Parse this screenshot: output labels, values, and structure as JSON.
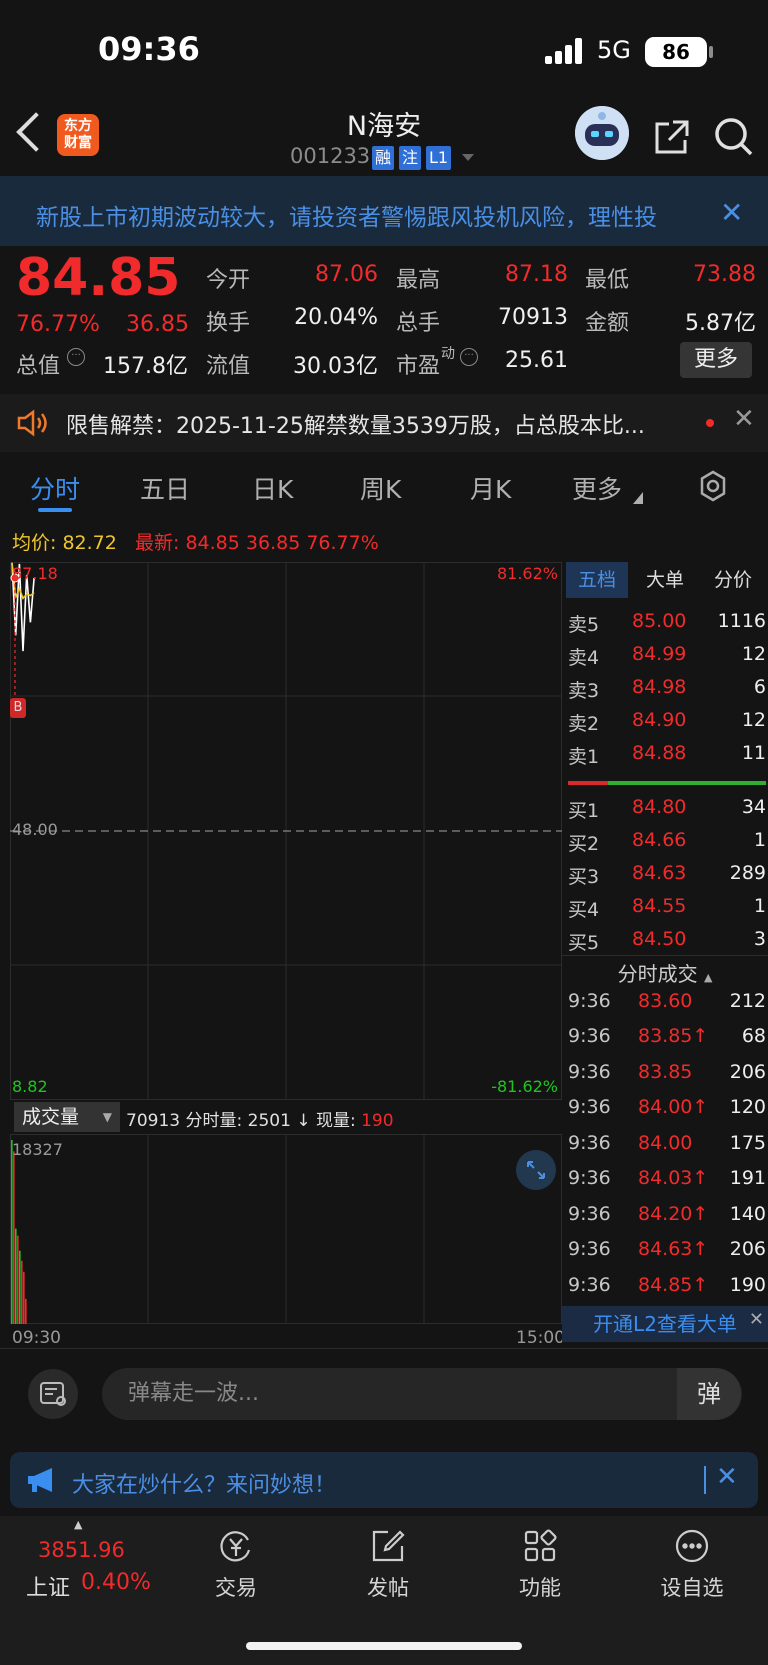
{
  "status": {
    "time": "09:36",
    "network": "5G",
    "battery": "86"
  },
  "header": {
    "name": "N海安",
    "code": "001233",
    "tags": [
      "融",
      "注",
      "L1"
    ],
    "logo_lines": [
      "东方",
      "财富"
    ]
  },
  "risk_banner": {
    "text": "新股上市初期波动较大，请投资者警惕跟风投机风险，理性投"
  },
  "quote": {
    "price": "84.85",
    "change_pct": "76.77%",
    "change": "36.85",
    "fields": [
      {
        "label": "今开",
        "value": "87.06",
        "color": "red"
      },
      {
        "label": "最高",
        "value": "87.18",
        "color": "red"
      },
      {
        "label": "最低",
        "value": "73.88",
        "color": "red"
      },
      {
        "label": "换手",
        "value": "20.04%",
        "color": "white"
      },
      {
        "label": "总手",
        "value": "70913",
        "color": "white"
      },
      {
        "label": "金额",
        "value": "5.87亿",
        "color": "white"
      },
      {
        "label": "总值",
        "value": "157.8亿",
        "color": "white"
      },
      {
        "label": "流值",
        "value": "30.03亿",
        "color": "white"
      },
      {
        "label": "市盈",
        "value": "25.61",
        "color": "white"
      }
    ],
    "pe_sup": "动",
    "more": "更多"
  },
  "notice": {
    "text": "限售解禁：2025-11-25解禁数量3539万股，占总股本比..."
  },
  "tabs": [
    "分时",
    "五日",
    "日K",
    "周K",
    "月K",
    "更多"
  ],
  "legend": {
    "avg_label": "均价:",
    "avg_value": "82.72",
    "latest_label": "最新:",
    "latest_price": "84.85",
    "latest_chg": "36.85",
    "latest_pct": "76.77%"
  },
  "chart_data": {
    "type": "line",
    "price_axis": {
      "top": "87.18",
      "mid": "48.00",
      "bottom": "8.82",
      "ylim": [
        8.82,
        87.18
      ]
    },
    "pct_axis": {
      "top": "81.62%",
      "bottom": "-81.62%"
    },
    "series": [
      {
        "name": "price",
        "x": [
          "09:30",
          "09:31",
          "09:32",
          "09:33",
          "09:34",
          "09:35",
          "09:36"
        ],
        "values": [
          87.06,
          76.5,
          86.9,
          74.2,
          85.3,
          78.4,
          84.85
        ],
        "color": "#ffffff"
      },
      {
        "name": "avg",
        "x": [
          "09:30",
          "09:31",
          "09:32",
          "09:33",
          "09:34",
          "09:35",
          "09:36"
        ],
        "values": [
          87.06,
          82.0,
          83.3,
          81.9,
          82.5,
          82.3,
          82.72
        ],
        "color": "#f0c62d"
      }
    ],
    "marker": "B",
    "time_start": "09:30",
    "time_end": "15:00"
  },
  "volume": {
    "select_label": "成交量",
    "total": "70913",
    "minute_label": "分时量:",
    "minute_value": "2501",
    "current_label": "现量:",
    "current_value": "190",
    "max_label": "18327",
    "bars": [
      {
        "value": 18327,
        "color": "#1fc51f"
      },
      {
        "value": 17200,
        "color": "#f12b2b"
      },
      {
        "value": 9500,
        "color": "#1fc51f"
      },
      {
        "value": 8800,
        "color": "#f12b2b"
      },
      {
        "value": 7300,
        "color": "#1fc51f"
      },
      {
        "value": 6300,
        "color": "#f12b2b"
      },
      {
        "value": 5200,
        "color": "#f12b2b"
      },
      {
        "value": 2501,
        "color": "#f12b2b"
      }
    ],
    "max": 18327
  },
  "orderbook": {
    "tabs": [
      "五档",
      "大单",
      "分价"
    ],
    "sells": [
      {
        "label": "卖5",
        "price": "85.00",
        "vol": "1116"
      },
      {
        "label": "卖4",
        "price": "84.99",
        "vol": "12"
      },
      {
        "label": "卖3",
        "price": "84.98",
        "vol": "6"
      },
      {
        "label": "卖2",
        "price": "84.90",
        "vol": "12"
      },
      {
        "label": "卖1",
        "price": "84.88",
        "vol": "11"
      }
    ],
    "buys": [
      {
        "label": "买1",
        "price": "84.80",
        "vol": "34"
      },
      {
        "label": "买2",
        "price": "84.66",
        "vol": "1"
      },
      {
        "label": "买3",
        "price": "84.63",
        "vol": "289"
      },
      {
        "label": "买4",
        "price": "84.55",
        "vol": "1"
      },
      {
        "label": "买5",
        "price": "84.50",
        "vol": "3"
      }
    ],
    "ticks_title": "分时成交",
    "ticks": [
      {
        "t": "9:36",
        "p": "83.60",
        "v": "212",
        "vc": "red"
      },
      {
        "t": "9:36",
        "p": "83.85↑",
        "v": "68",
        "vc": "red"
      },
      {
        "t": "9:36",
        "p": "83.85",
        "v": "206",
        "vc": "red"
      },
      {
        "t": "9:36",
        "p": "84.00↑",
        "v": "120",
        "vc": "red"
      },
      {
        "t": "9:36",
        "p": "84.00",
        "v": "175",
        "vc": "red"
      },
      {
        "t": "9:36",
        "p": "84.03↑",
        "v": "191",
        "vc": "red"
      },
      {
        "t": "9:36",
        "p": "84.20↑",
        "v": "140",
        "vc": "green"
      },
      {
        "t": "9:36",
        "p": "84.63↑",
        "v": "206",
        "vc": "red"
      },
      {
        "t": "9:36",
        "p": "84.85↑",
        "v": "190",
        "vc": "red"
      }
    ],
    "l2_button": "开通L2查看大单"
  },
  "comment": {
    "placeholder": "弹幕走一波...",
    "send": "弹"
  },
  "ask": {
    "text": "大家在炒什么？来问妙想！"
  },
  "nav": {
    "index_value": "3851.96",
    "index_name": "上证",
    "index_pct": "0.40%",
    "items": [
      "交易",
      "发帖",
      "功能",
      "设自选"
    ]
  }
}
